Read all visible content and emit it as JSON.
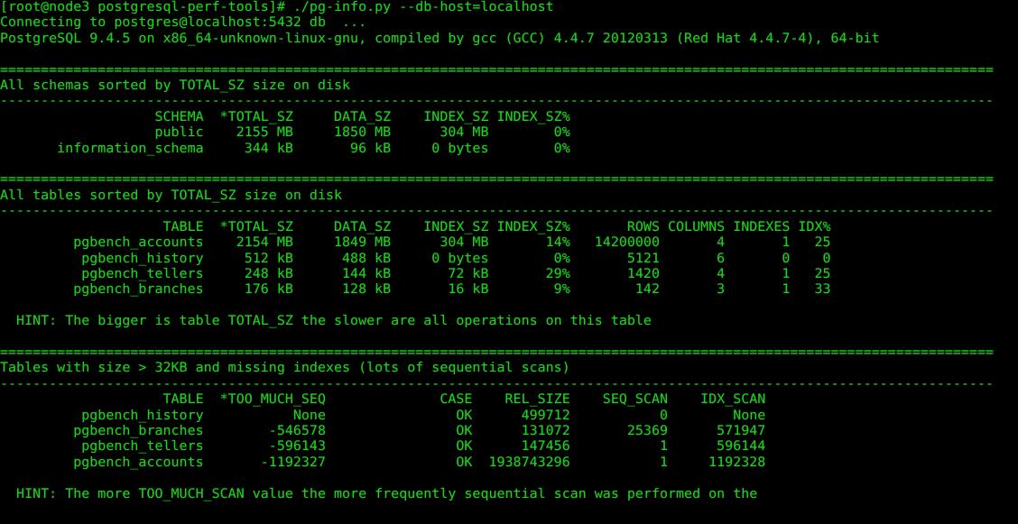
{
  "terminal": {
    "colors": {
      "background": "#000000",
      "foreground": "#1fd01f"
    },
    "columns": 122,
    "rows": 34
  },
  "prompt": {
    "user": "root",
    "host": "node3",
    "cwd": "postgresql-perf-tools",
    "symbol": "#",
    "full": "[root@node3 postgresql-perf-tools]#",
    "command": "./pg-info.py --db-host=localhost"
  },
  "output": {
    "connecting_line": "Connecting to postgres@localhost:5432 db  ...",
    "version_line": "PostgreSQL 9.4.5 on x86_64-unknown-linux-gnu, compiled by gcc (GCC) 4.4.7 20120313 (Red Hat 4.4.7-4), 64-bit",
    "separator_equals": "==========================================================================================================================",
    "separator_dashes": "--------------------------------------------------------------------------------------------------------------------------"
  },
  "sections": [
    {
      "title": "All schemas sorted by TOTAL_SZ size on disk",
      "headers": [
        "SCHEMA",
        "*TOTAL_SZ",
        "DATA_SZ",
        "INDEX_SZ",
        "INDEX_SZ%"
      ],
      "rows": [
        [
          "public",
          "2155 MB",
          "1850 MB",
          "304 MB",
          "0%"
        ],
        [
          "information_schema",
          "344 kB",
          "96 kB",
          "0 bytes",
          "0%"
        ]
      ],
      "hint": ""
    },
    {
      "title": "All tables sorted by TOTAL_SZ size on disk",
      "headers": [
        "TABLE",
        "*TOTAL_SZ",
        "DATA_SZ",
        "INDEX_SZ",
        "INDEX_SZ%",
        "ROWS",
        "COLUMNS",
        "INDEXES",
        "IDX%"
      ],
      "rows": [
        [
          "pgbench_accounts",
          "2154 MB",
          "1849 MB",
          "304 MB",
          "14%",
          "14200000",
          "4",
          "1",
          "25"
        ],
        [
          "pgbench_history",
          "512 kB",
          "488 kB",
          "0 bytes",
          "0%",
          "5121",
          "6",
          "0",
          "0"
        ],
        [
          "pgbench_tellers",
          "248 kB",
          "144 kB",
          "72 kB",
          "29%",
          "1420",
          "4",
          "1",
          "25"
        ],
        [
          "pgbench_branches",
          "176 kB",
          "128 kB",
          "16 kB",
          "9%",
          "142",
          "3",
          "1",
          "33"
        ]
      ],
      "hint": "HINT: The bigger is table TOTAL_SZ the slower are all operations on this table"
    },
    {
      "title": "Tables with size > 32KB and missing indexes (lots of sequential scans)",
      "headers": [
        "TABLE",
        "*TOO_MUCH_SEQ",
        "CASE",
        "REL_SIZE",
        "SEQ_SCAN",
        "IDX_SCAN"
      ],
      "rows": [
        [
          "pgbench_history",
          "None",
          "OK",
          "499712",
          "0",
          "None"
        ],
        [
          "pgbench_branches",
          "-546578",
          "OK",
          "131072",
          "25369",
          "571947"
        ],
        [
          "pgbench_tellers",
          "-596143",
          "OK",
          "147456",
          "1",
          "596144"
        ],
        [
          "pgbench_accounts",
          "-1192327",
          "OK",
          "1938743296",
          "1",
          "1192328"
        ]
      ],
      "hint": "HINT: The more TOO_MUCH_SCAN value the more frequently sequential scan was performed on the"
    }
  ],
  "screen_lines": [
    "[root@node3 postgresql-perf-tools]# ./pg-info.py --db-host=localhost",
    "Connecting to postgres@localhost:5432 db  ...",
    "PostgreSQL 9.4.5 on x86_64-unknown-linux-gnu, compiled by gcc (GCC) 4.4.7 20120313 (Red Hat 4.4.7-4), 64-bit",
    "",
    "==========================================================================================================================",
    "All schemas sorted by TOTAL_SZ size on disk",
    "--------------------------------------------------------------------------------------------------------------------------",
    "                   SCHEMA  *TOTAL_SZ     DATA_SZ    INDEX_SZ INDEX_SZ%",
    "                   public    2155 MB     1850 MB      304 MB        0%",
    "       information_schema     344 kB       96 kB     0 bytes        0%",
    "",
    "==========================================================================================================================",
    "All tables sorted by TOTAL_SZ size on disk",
    "--------------------------------------------------------------------------------------------------------------------------",
    "                    TABLE  *TOTAL_SZ     DATA_SZ    INDEX_SZ INDEX_SZ%       ROWS COLUMNS INDEXES IDX%",
    "         pgbench_accounts    2154 MB     1849 MB      304 MB       14%   14200000       4       1   25",
    "          pgbench_history     512 kB      488 kB     0 bytes        0%       5121       6       0    0",
    "          pgbench_tellers     248 kB      144 kB       72 kB       29%       1420       4       1   25",
    "         pgbench_branches     176 kB      128 kB       16 kB        9%        142       3       1   33",
    "",
    "  HINT: The bigger is table TOTAL_SZ the slower are all operations on this table",
    "",
    "==========================================================================================================================",
    "Tables with size > 32KB and missing indexes (lots of sequential scans)",
    "--------------------------------------------------------------------------------------------------------------------------",
    "                    TABLE  *TOO_MUCH_SEQ              CASE    REL_SIZE    SEQ_SCAN    IDX_SCAN",
    "          pgbench_history           None                OK      499712           0        None",
    "         pgbench_branches        -546578                OK      131072       25369      571947",
    "          pgbench_tellers        -596143                OK      147456           1      596144",
    "         pgbench_accounts       -1192327                OK  1938743296           1     1192328",
    "",
    "  HINT: The more TOO_MUCH_SCAN value the more frequently sequential scan was performed on the"
  ]
}
